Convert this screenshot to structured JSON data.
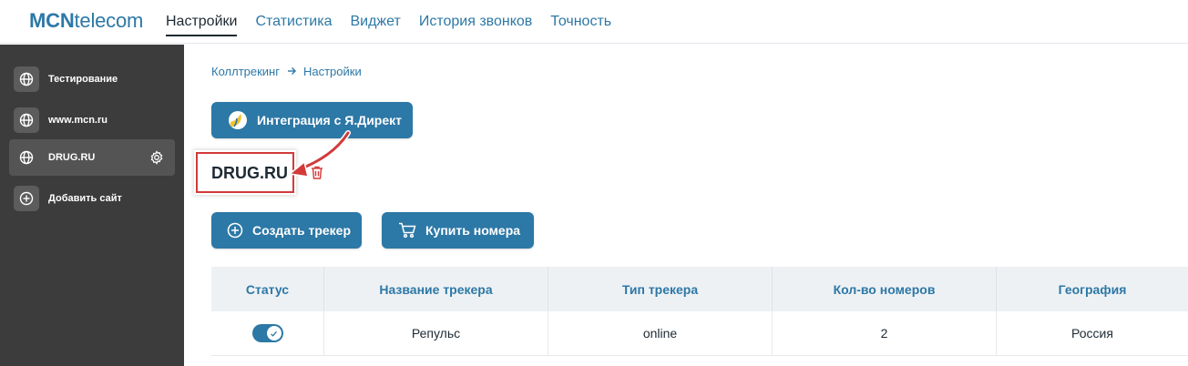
{
  "header": {
    "logo_bold": "MCN",
    "logo_rest": "telecom",
    "nav": [
      "Настройки",
      "Статистика",
      "Виджет",
      "История звонков",
      "Точность"
    ],
    "active_index": 0
  },
  "sidebar": {
    "items": [
      {
        "label": "Тестирование",
        "icon": "globe-icon"
      },
      {
        "label": "www.mcn.ru",
        "icon": "globe-icon"
      },
      {
        "label": "DRUG.RU",
        "icon": "globe-icon",
        "active": true,
        "settings_icon": "gear-icon"
      },
      {
        "label": "Добавить сайт",
        "icon": "plus-circle-icon"
      }
    ]
  },
  "breadcrumb": {
    "root": "Коллтрекинг",
    "current": "Настройки"
  },
  "integration_button": {
    "label": "Интеграция с Я.Директ",
    "icon": "yandex-direct-logo"
  },
  "site": {
    "name": "DRUG.RU",
    "delete_icon": "trash-icon"
  },
  "actions": {
    "create_tracker": "Создать трекер",
    "buy_numbers": "Купить номера"
  },
  "table": {
    "columns": [
      "Статус",
      "Название трекера",
      "Тип трекера",
      "Кол-во номеров",
      "География"
    ],
    "rows": [
      {
        "status_on": true,
        "name": "Репульс",
        "type": "online",
        "count": "2",
        "geo": "Россия"
      }
    ]
  },
  "colors": {
    "accent": "#2c78a6",
    "sidebar": "#3c3c3c",
    "highlight": "#d23a3a"
  }
}
